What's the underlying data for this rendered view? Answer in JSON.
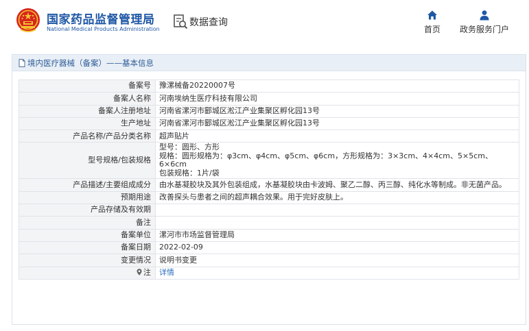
{
  "header": {
    "org_name_cn": "国家药品监督管理局",
    "org_name_en": "National Medical Products Administration",
    "data_query_label": "数据查询",
    "nav": [
      {
        "label": "首页",
        "icon": "home-icon"
      },
      {
        "label": "政务服务门户",
        "icon": "user-icon"
      }
    ]
  },
  "panel": {
    "title": "境内医疗器械（备案）——基本信息",
    "rows": [
      {
        "key": "备案号",
        "value": "豫漯械备20220007号"
      },
      {
        "key": "备案人名称",
        "value": "河南埃纳生医疗科技有限公司"
      },
      {
        "key": "备案人注册地址",
        "value": "河南省漯河市郾城区淞江产业集聚区孵化园13号"
      },
      {
        "key": "生产地址",
        "value": "河南省漯河市郾城区淞江产业集聚区孵化园13号"
      },
      {
        "key": "产品名称/产品分类名称",
        "value": "超声贴片"
      },
      {
        "key": "型号规格/包装规格",
        "lines": [
          "型号：圆形、方形",
          "规格：圆形规格为：φ3cm、φ4cm、φ5cm、φ6cm，方形规格为：3×3cm、4×4cm、5×5cm、6×6cm",
          "包装规格：1片/袋"
        ]
      },
      {
        "key": "产品描述/主要组成成分",
        "value": "由水基凝胶块及其外包装组成，水基凝胶块由卡波姆、聚乙二醇、丙三醇、纯化水等制成。非无菌产品。"
      },
      {
        "key": "预期用途",
        "value": "改善探头与患者之间的超声耦合效果。用于完好皮肤上。"
      },
      {
        "key": "产品存储及有效期",
        "value": ""
      },
      {
        "key": "备注",
        "value": ""
      },
      {
        "key": "备案单位",
        "value": "漯河市市场监督管理局"
      },
      {
        "key": "备案日期",
        "value": "2022-02-09"
      },
      {
        "key": "变更情况",
        "value": "说明书变更"
      },
      {
        "key": "注",
        "value": "详情",
        "key_icon": "pin-icon"
      }
    ]
  },
  "colors": {
    "brand_blue": "#1f57a6",
    "link_blue": "#2e6fc0",
    "panel_header_bg": "#e9eff6",
    "label_cell_bg": "#f3f4f6"
  }
}
